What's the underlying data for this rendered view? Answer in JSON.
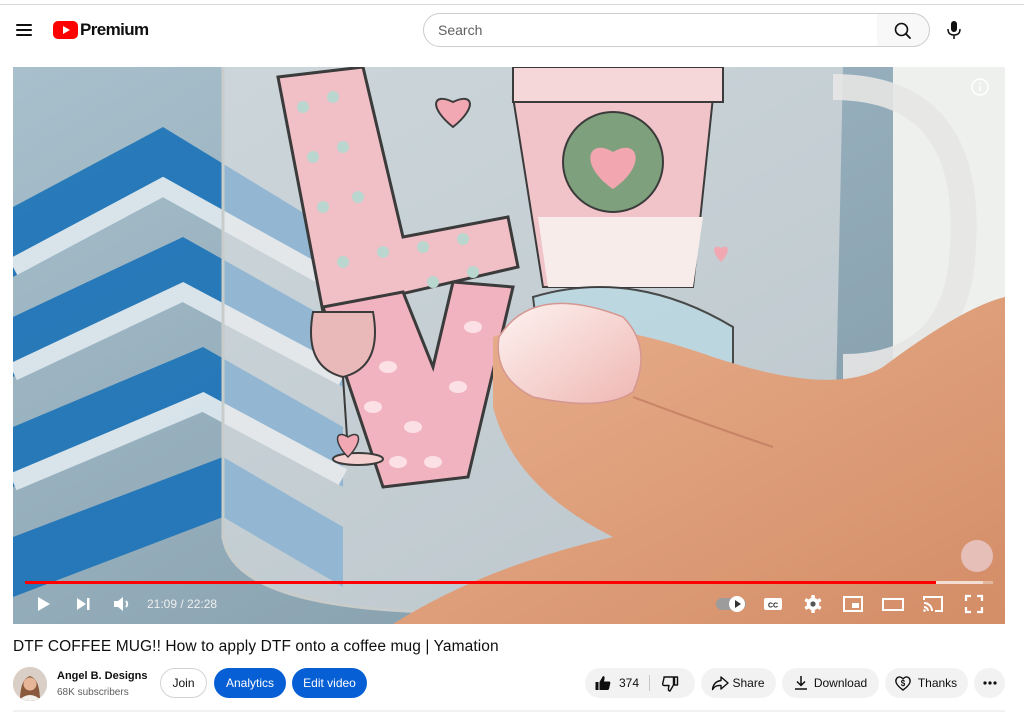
{
  "masthead": {
    "logo_text": "Premium",
    "search_placeholder": "Search"
  },
  "player": {
    "time_current": "21:09",
    "time_total": "22:28",
    "time_display": "21:09 / 22:28",
    "progress_fraction": 0.9412,
    "buffer_fraction": 0.99,
    "accent_color": "#ff0000"
  },
  "video": {
    "title": "DTF COFFEE MUG!! How to apply DTF onto a coffee mug | Yamation"
  },
  "owner": {
    "channel_name": "Angel B. Designs",
    "subscribers": "68K subscribers",
    "join_label": "Join",
    "analytics_label": "Analytics",
    "edit_label": "Edit video"
  },
  "actions": {
    "like_count": "374",
    "share_label": "Share",
    "download_label": "Download",
    "thanks_label": "Thanks"
  },
  "icons": [
    "menu-icon",
    "youtube-logo-icon",
    "search-icon",
    "mic-icon",
    "info-icon",
    "play-icon",
    "next-icon",
    "volume-icon",
    "autoplay-toggle-icon",
    "captions-icon",
    "settings-icon",
    "miniplayer-icon",
    "theater-icon",
    "cast-icon",
    "fullscreen-icon",
    "thumbs-up-icon",
    "thumbs-down-icon",
    "share-icon",
    "download-icon",
    "thanks-icon",
    "more-icon"
  ]
}
